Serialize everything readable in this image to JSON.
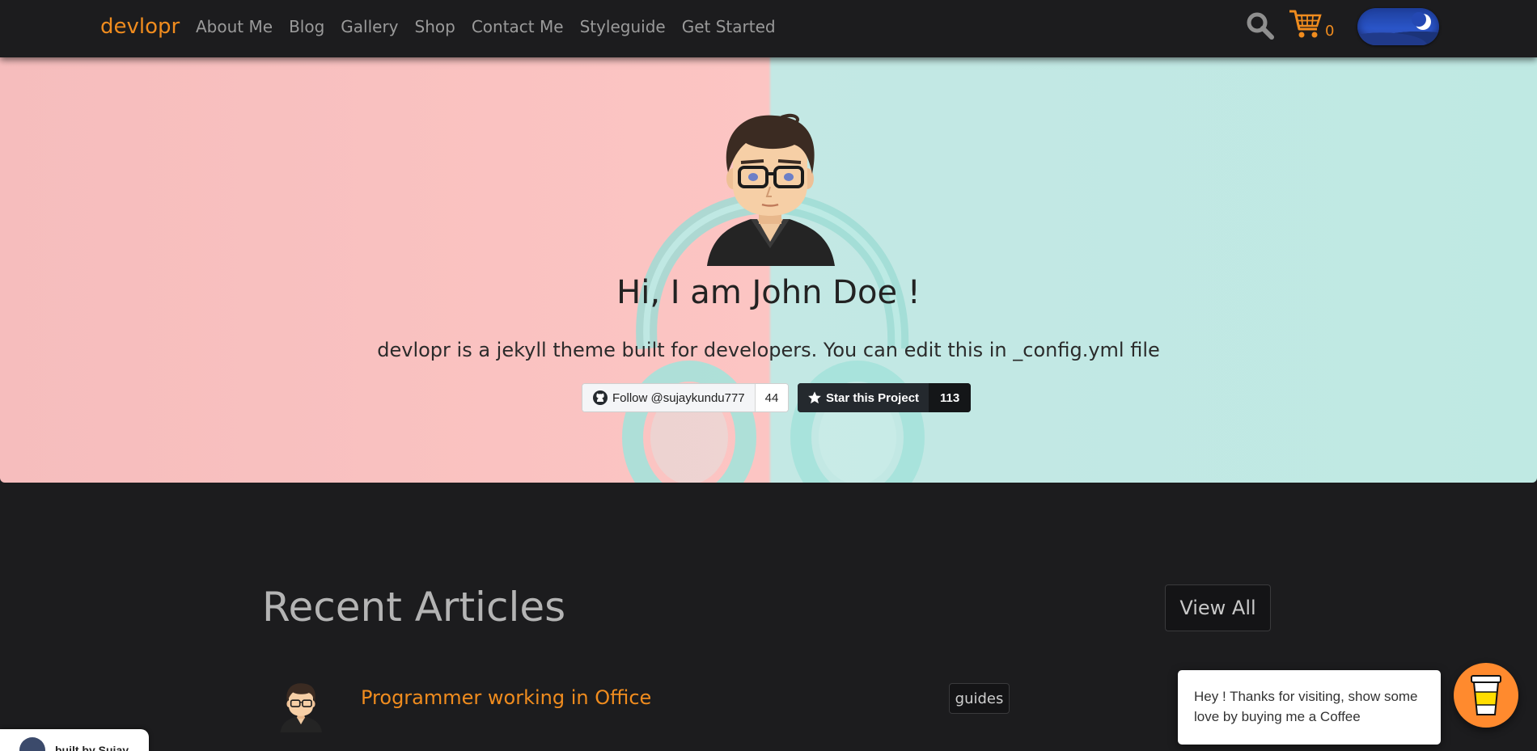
{
  "navbar": {
    "brand": "devlopr",
    "links": [
      "About Me",
      "Blog",
      "Gallery",
      "Shop",
      "Contact Me",
      "Styleguide",
      "Get Started"
    ],
    "cart_count": "0",
    "theme_toggle": "dark"
  },
  "hero": {
    "title": "Hi, I am John Doe !",
    "subtitle": "devlopr is a jekyll theme built for developers. You can edit this in _config.yml file",
    "follow": {
      "label": "Follow @sujaykundu777",
      "count": "44"
    },
    "star": {
      "label": "Star this Project",
      "count": "113"
    }
  },
  "articles": {
    "heading": "Recent Articles",
    "view_all": "View All",
    "items": [
      {
        "title": "Programmer working in Office",
        "tag": "guides"
      }
    ]
  },
  "coffee": {
    "message": "Hey ! Thanks for visiting, show some love by buying me a Coffee"
  },
  "built_by": "built by Sujay",
  "colors": {
    "accent": "#f08c1e",
    "background": "#1c1c1e",
    "hero_left": "#fcc5c3",
    "hero_right": "#c3e8e4",
    "coffee_button": "#ff8a2e"
  }
}
